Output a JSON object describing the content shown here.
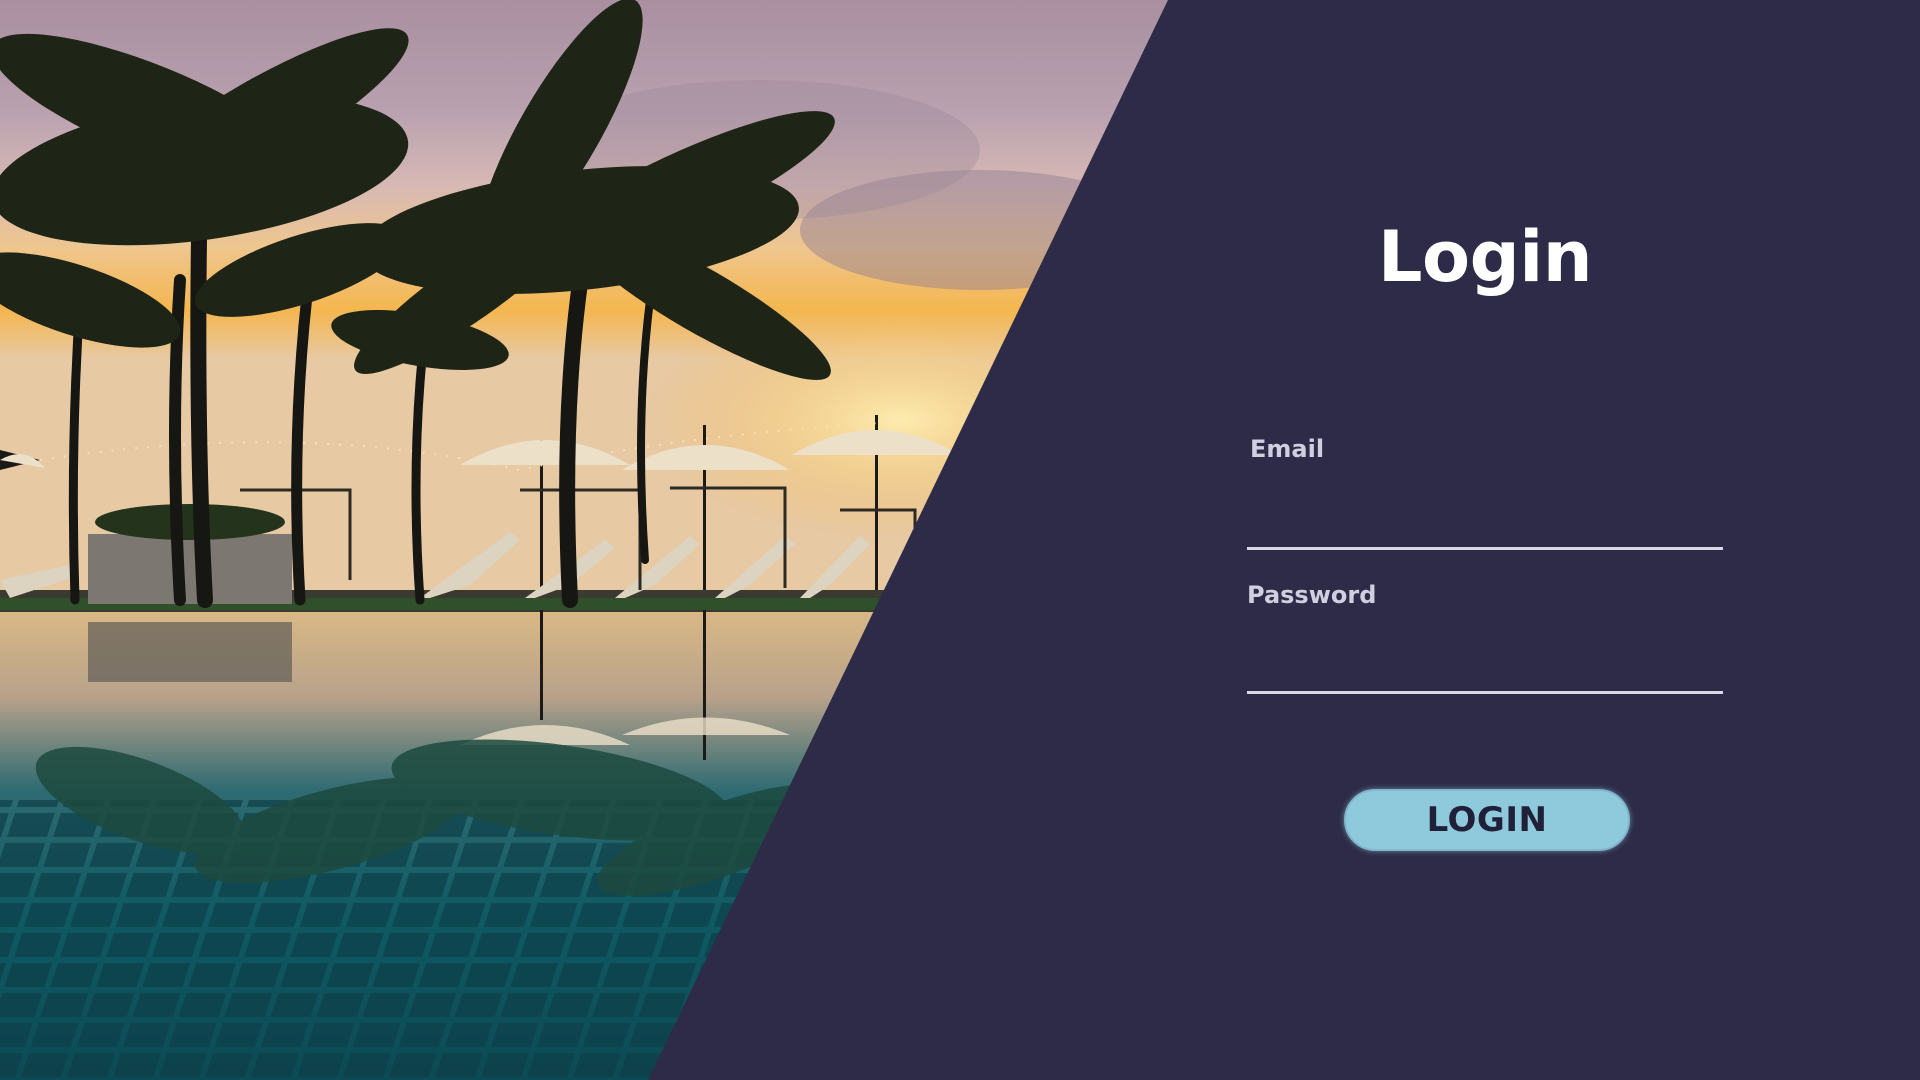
{
  "login": {
    "title": "Login",
    "email_label": "Email",
    "email_value": "",
    "password_label": "Password",
    "password_value": "",
    "button_label": "LOGIN"
  },
  "colors": {
    "panel_background": "#2d2b47",
    "title_text": "#ffffff",
    "label_text": "#cfcfe0",
    "input_underline": "#d9d9e6",
    "button_background": "#8fc9dc",
    "button_text": "#202038"
  },
  "hero_image": {
    "scene": "resort-pool-at-sunset",
    "elements": [
      "palm-trees",
      "beach-umbrellas",
      "lounge-chairs",
      "reflection-pool",
      "sunset-sky"
    ]
  }
}
